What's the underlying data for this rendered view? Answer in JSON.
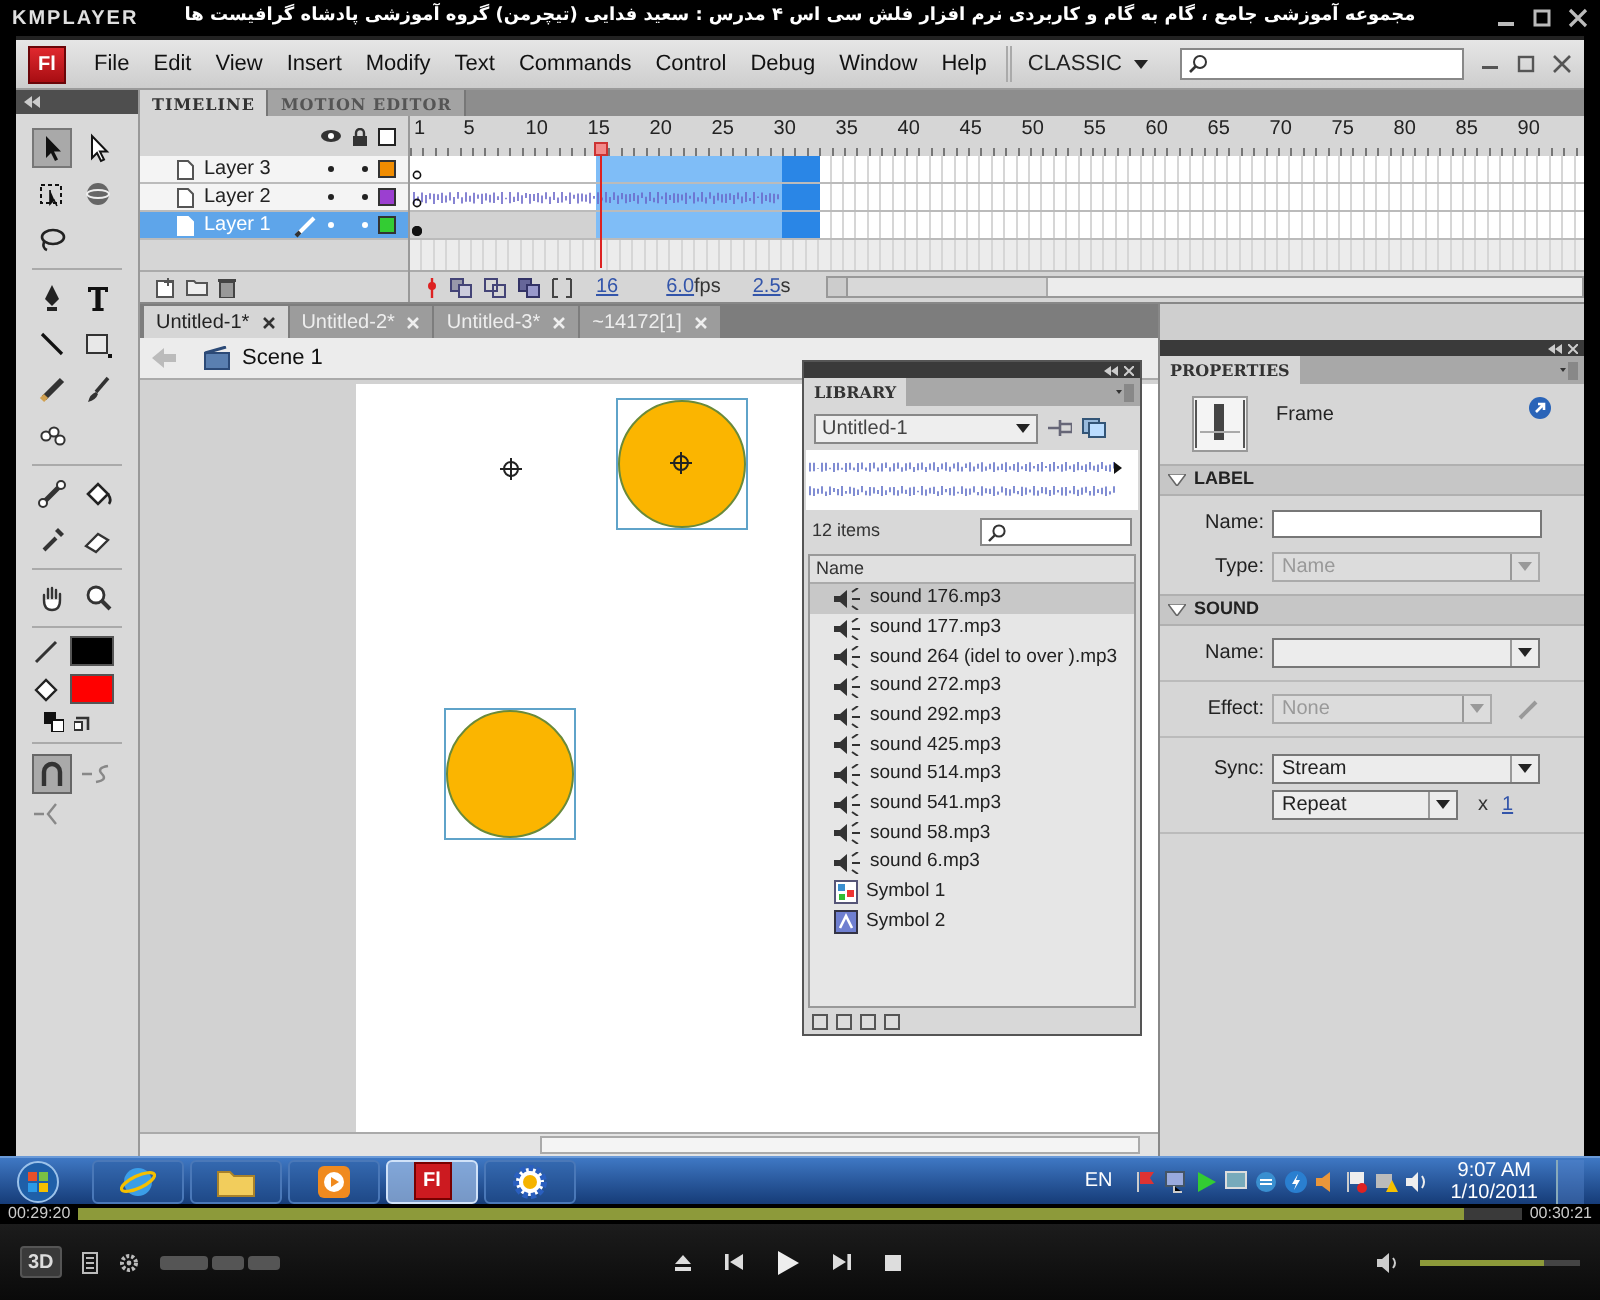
{
  "player": {
    "logo": "KMPLAYER",
    "title": "مجموعه آموزشی جامع ، گام به گام و کاربردی نرم افزار فلش سی اس ۴ مدرس : سعید فدایی (تیچرمن) گروه آموزشی پادشاه گرافیست ها",
    "time_elapsed": "00:29:20",
    "time_total": "00:30:21",
    "level": 0.96,
    "mode_button": "3D",
    "volume": {
      "level": 0.78
    }
  },
  "flash": {
    "logo": "Fl",
    "menu": [
      "File",
      "Edit",
      "View",
      "Insert",
      "Modify",
      "Text",
      "Commands",
      "Control",
      "Debug",
      "Window",
      "Help"
    ],
    "workspace": "CLASSIC",
    "tool_groups": [
      [
        {
          "kind": "selection",
          "selected": true
        },
        {
          "kind": "subselection",
          "selected": false
        },
        {
          "kind": "free_transform",
          "selected": false
        },
        {
          "kind": "rotation_3d",
          "selected": false
        },
        {
          "kind": "lasso",
          "selected": false
        }
      ],
      [
        {
          "kind": "pen",
          "selected": false
        },
        {
          "kind": "text",
          "selected": false
        },
        {
          "kind": "line",
          "selected": false
        },
        {
          "kind": "rectangle",
          "selected": false
        },
        {
          "kind": "pencil",
          "selected": false
        },
        {
          "kind": "brush",
          "selected": false
        },
        {
          "kind": "deco",
          "selected": false
        }
      ],
      [
        {
          "kind": "bone",
          "selected": false
        },
        {
          "kind": "paint_bucket",
          "selected": false
        },
        {
          "kind": "eyedropper",
          "selected": false
        },
        {
          "kind": "eraser",
          "selected": false
        }
      ],
      [
        {
          "kind": "hand",
          "selected": false
        },
        {
          "kind": "zoom",
          "selected": false
        }
      ]
    ],
    "snap": {
      "on": true
    },
    "timeline": {
      "tabs": [
        {
          "label": "TIMELINE",
          "selected": true
        },
        {
          "label": "MOTION EDITOR",
          "selected": false
        }
      ],
      "frame_numbers": [
        "1",
        "5",
        "10",
        "15",
        "20",
        "25",
        "30",
        "35",
        "40",
        "45",
        "50",
        "55",
        "60",
        "65",
        "70",
        "75",
        "80",
        "85",
        "90"
      ],
      "layers": [
        {
          "name": "Layer 3",
          "selected": false,
          "editing": false,
          "has_sound": false,
          "color": "#f08c00"
        },
        {
          "name": "Layer 2",
          "selected": false,
          "editing": false,
          "has_sound": true,
          "color": "#9b3fd0"
        },
        {
          "name": "Layer 1",
          "selected": true,
          "editing": true,
          "has_sound": false,
          "color": "#33cc33"
        }
      ],
      "current_frame": "16",
      "fps": "6.0",
      "fps_unit": "fps",
      "time": "2.5",
      "time_unit": "s"
    },
    "document_tabs": [
      {
        "label": "Untitled-1*",
        "selected": true
      },
      {
        "label": "Untitled-2*",
        "selected": false
      },
      {
        "label": "Untitled-3*",
        "selected": false
      },
      {
        "label": "~14172[1]",
        "selected": false
      }
    ],
    "scene": "Scene 1",
    "library": {
      "title": "LIBRARY",
      "document": "Untitled-1",
      "count": "12 items",
      "column": "Name",
      "items": [
        {
          "name": "sound 176.mp3",
          "kind": "sound",
          "selected": true
        },
        {
          "name": "sound 177.mp3",
          "kind": "sound",
          "selected": false
        },
        {
          "name": "sound 264 (idel to over ).mp3",
          "kind": "sound",
          "selected": false
        },
        {
          "name": "sound 272.mp3",
          "kind": "sound",
          "selected": false
        },
        {
          "name": "sound 292.mp3",
          "kind": "sound",
          "selected": false
        },
        {
          "name": "sound 425.mp3",
          "kind": "sound",
          "selected": false
        },
        {
          "name": "sound 514.mp3",
          "kind": "sound",
          "selected": false
        },
        {
          "name": "sound 541.mp3",
          "kind": "sound",
          "selected": false
        },
        {
          "name": "sound 58.mp3",
          "kind": "sound",
          "selected": false
        },
        {
          "name": "sound 6.mp3",
          "kind": "sound",
          "selected": false
        },
        {
          "name": "Symbol 1",
          "kind": "graphic",
          "selected": false
        },
        {
          "name": "Symbol 2",
          "kind": "movie_clip",
          "selected": false
        }
      ]
    },
    "properties": {
      "title": "PROPERTIES",
      "type": "Frame",
      "label_section": {
        "heading": "LABEL",
        "name_label": "Name:",
        "type_label": "Type:",
        "type_value": "Name"
      },
      "sound_section": {
        "heading": "SOUND",
        "name_label": "Name:",
        "effect_label": "Effect:",
        "effect_value": "None",
        "sync_label": "Sync:",
        "sync_value": "Stream",
        "repeat_value": "Repeat",
        "times_sign": "x",
        "repeat_count": "1"
      }
    }
  },
  "taskbar": {
    "apps": [
      {
        "kind": "browser",
        "active": false
      },
      {
        "kind": "folder",
        "active": false
      },
      {
        "kind": "media",
        "active": false
      },
      {
        "kind": "flash",
        "label": "Fl",
        "active": true
      },
      {
        "kind": "settings",
        "active": false
      }
    ],
    "language": "EN",
    "time": "9:07 AM",
    "date": "1/10/2011"
  }
}
